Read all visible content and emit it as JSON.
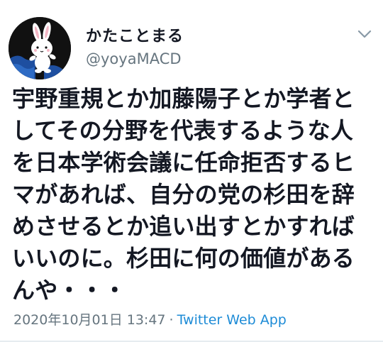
{
  "author": {
    "display_name": "かたことまる",
    "handle": "@yoyaMACD",
    "avatar_icon": "white-rabbit-avatar-icon"
  },
  "menu": {
    "icon": "chevron-down-icon"
  },
  "tweet": {
    "lines": [
      "宇野重規とか加藤陽子とか学者と",
      "してその分野を代表するような人",
      "を日本学術会議に任命拒否するヒ",
      "マがあれば、自分の党の杉田を辞",
      "めさせるとか追い出すとかすれば",
      "いいのに。杉田に何の価値がある",
      "んや・・・"
    ]
  },
  "meta": {
    "timestamp": "2020年10月01日 13:47",
    "separator": "·",
    "source_app": "Twitter Web App"
  },
  "colors": {
    "text": "#141823",
    "muted": "#66757f",
    "link": "#1d8bd6",
    "avatar_bg": "#111111",
    "avatar_wave": "#1e4fa0"
  }
}
